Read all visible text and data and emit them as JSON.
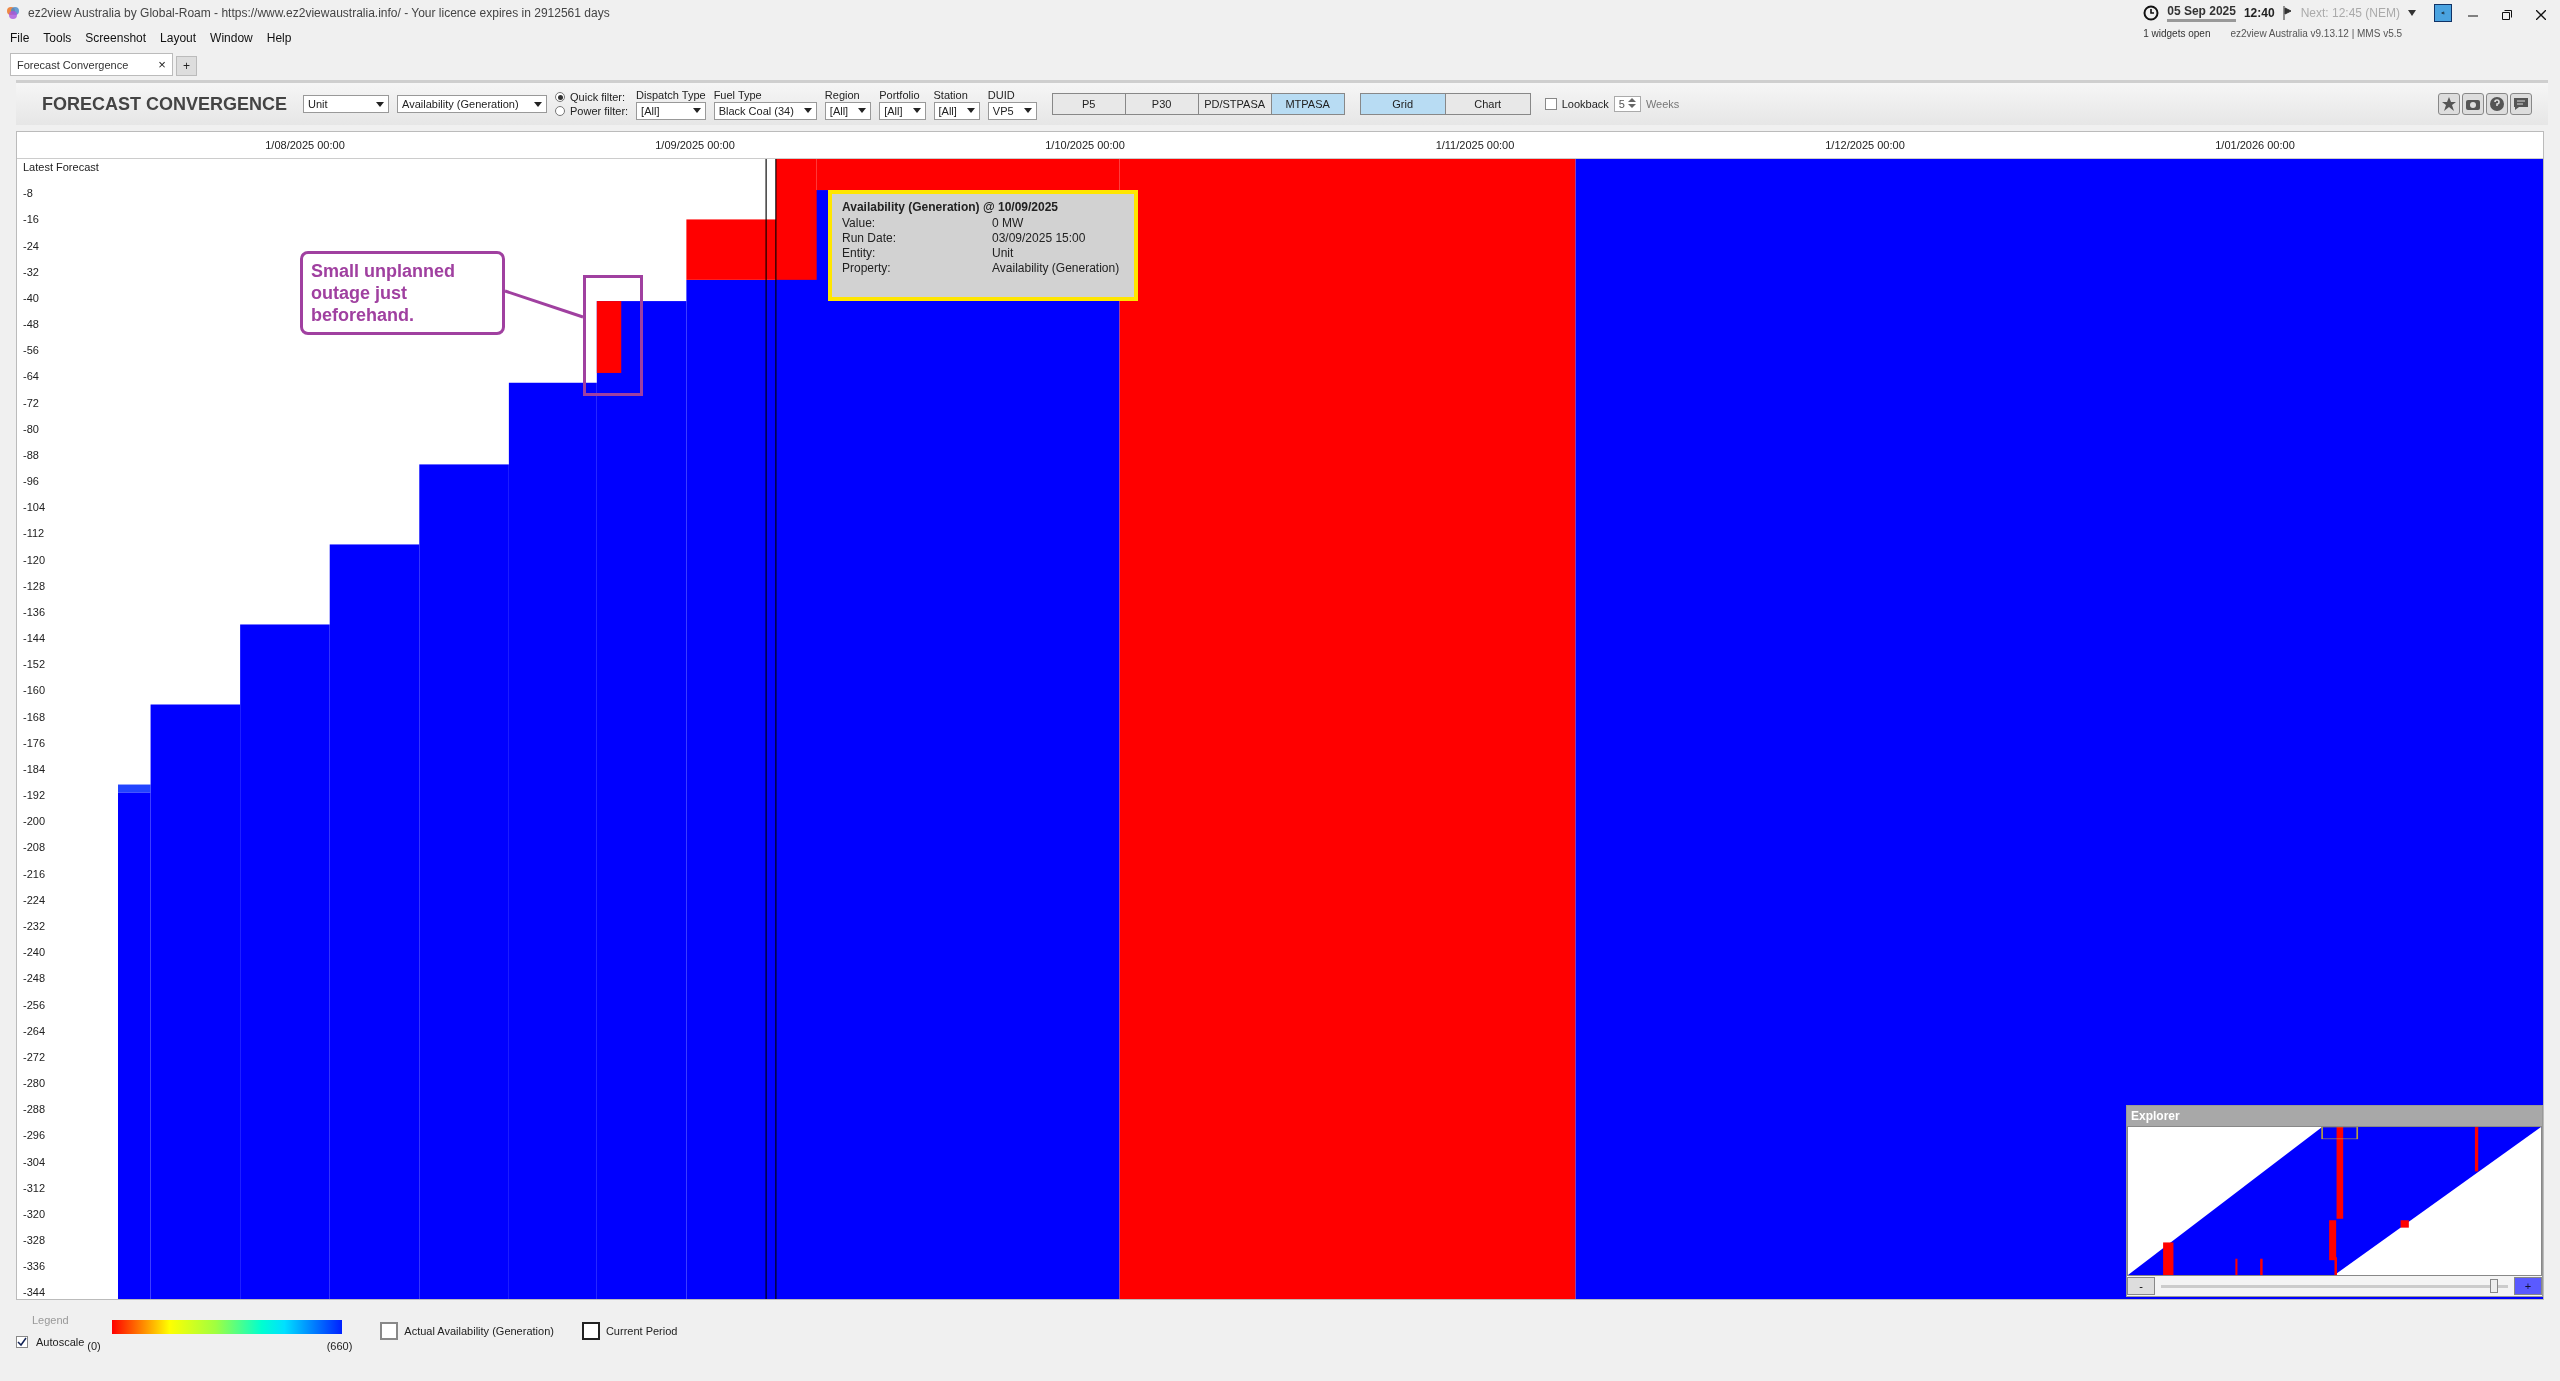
{
  "window": {
    "title": "ez2view Australia by Global-Roam - https://www.ez2viewaustralia.info/ - Your licence expires in 2912561 days"
  },
  "status": {
    "date": "05 Sep 2025",
    "time": "12:40",
    "next": "Next: 12:45  (NEM)",
    "widgets": "1 widgets open",
    "version": "ez2view Australia v9.13.12 | MMS v5.5"
  },
  "menu": [
    "File",
    "Tools",
    "Screenshot",
    "Layout",
    "Window",
    "Help"
  ],
  "tabs": [
    {
      "label": "Forecast Convergence",
      "selected": true,
      "close": "×"
    }
  ],
  "new_tab": "+",
  "toolbar": {
    "title": "FORECAST CONVERGENCE",
    "entity": "Unit",
    "property": "Availability (Generation)",
    "filter_modes": [
      {
        "label": "Quick filter:",
        "selected": true
      },
      {
        "label": "Power filter:",
        "selected": false
      }
    ],
    "filters": [
      {
        "label": "Dispatch Type",
        "value": "[All]"
      },
      {
        "label": "Fuel Type",
        "value": "Black Coal (34)"
      },
      {
        "label": "Region",
        "value": "[All]"
      },
      {
        "label": "Portfolio",
        "value": "[All]"
      },
      {
        "label": "Station",
        "value": "[All]"
      },
      {
        "label": "DUID",
        "value": "VP5"
      }
    ],
    "periods": [
      {
        "label": "P5",
        "selected": false
      },
      {
        "label": "P30",
        "selected": false
      },
      {
        "label": "PD/STPASA",
        "selected": false
      },
      {
        "label": "MTPASA",
        "selected": true
      }
    ],
    "views": [
      {
        "label": "Grid",
        "selected": true
      },
      {
        "label": "Chart",
        "selected": false
      }
    ],
    "lookback": {
      "label": "Lookback",
      "checked": false,
      "value": "5",
      "unit": "Weeks"
    }
  },
  "grid": {
    "y_title": "Latest Forecast",
    "x_labels": [
      "1/08/2025 00:00",
      "1/09/2025 00:00",
      "1/10/2025 00:00",
      "1/11/2025 00:00",
      "1/12/2025 00:00",
      "1/01/2026 00:00"
    ],
    "y_labels": [
      "-8",
      "-16",
      "-24",
      "-32",
      "-40",
      "-48",
      "-56",
      "-64",
      "-72",
      "-80",
      "-88",
      "-96",
      "-104",
      "-112",
      "-120",
      "-128",
      "-136",
      "-144",
      "-152",
      "-160",
      "-168",
      "-176",
      "-184",
      "-192",
      "-200",
      "-208",
      "-216",
      "-224",
      "-232",
      "-240",
      "-248",
      "-256",
      "-264",
      "-272",
      "-280",
      "-288",
      "-296",
      "-304",
      "-312",
      "-320",
      "-328",
      "-336",
      "-344"
    ],
    "tooltip": {
      "title": "Availability (Generation) @ 10/09/2025",
      "rows": [
        {
          "label": "Value:",
          "value": "0 MW"
        },
        {
          "label": "Run Date:",
          "value": "03/09/2025 15:00"
        },
        {
          "label": "Entity:",
          "value": "Unit"
        },
        {
          "label": "Property:",
          "value": "Availability (Generation)"
        }
      ]
    },
    "annotation": "Small unplanned outage just beforehand."
  },
  "explorer": {
    "title": "Explorer",
    "zoom_out": "-",
    "zoom_in": "+",
    "level": 0.97
  },
  "legend": {
    "title": "Legend",
    "autoscale": {
      "label": "Autoscale",
      "checked": true
    },
    "min": "(0)",
    "max": "(660)",
    "keys": [
      {
        "label": "Actual Availability (Generation)",
        "kind": "thin"
      },
      {
        "label": "Current Period",
        "kind": "thick"
      }
    ]
  }
}
